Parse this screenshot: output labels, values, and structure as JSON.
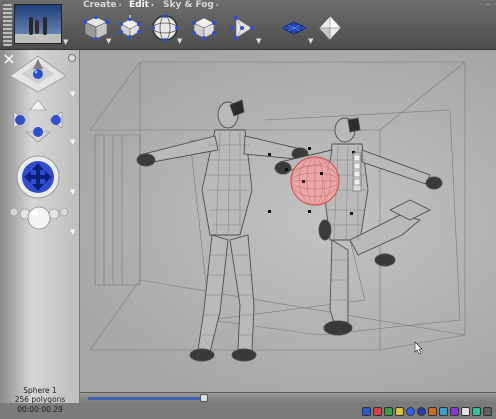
{
  "toolbar": {
    "menus": [
      {
        "label": "Create",
        "active": false
      },
      {
        "label": "Edit",
        "active": true
      },
      {
        "label": "Sky & Fog",
        "active": false
      }
    ],
    "tools": [
      {
        "icon": "cube-icon"
      },
      {
        "icon": "move-vertices-icon"
      },
      {
        "icon": "sphere-cage-icon"
      },
      {
        "icon": "scale-cage-icon"
      },
      {
        "icon": "pyramid-points-icon"
      },
      {
        "icon": "grid-mesh-icon"
      },
      {
        "icon": "diamond-icon"
      }
    ],
    "minimize_label": "–"
  },
  "left_panel": {
    "controls": [
      "pan-view-control",
      "dolly-view-control",
      "move-arrows-control",
      "zoom-sphere-control"
    ]
  },
  "info": {
    "object_name": "Sphere 1",
    "polygon_count": "256 polygons",
    "time": "00:00:00.29"
  },
  "timeline": {
    "progress": 0.29
  },
  "colors": {
    "accent": "#2f4fd0",
    "selection": "#e06a6a",
    "toolbar_bg": "#5a5a5a",
    "viewport_bg": "#b7b7b7"
  }
}
